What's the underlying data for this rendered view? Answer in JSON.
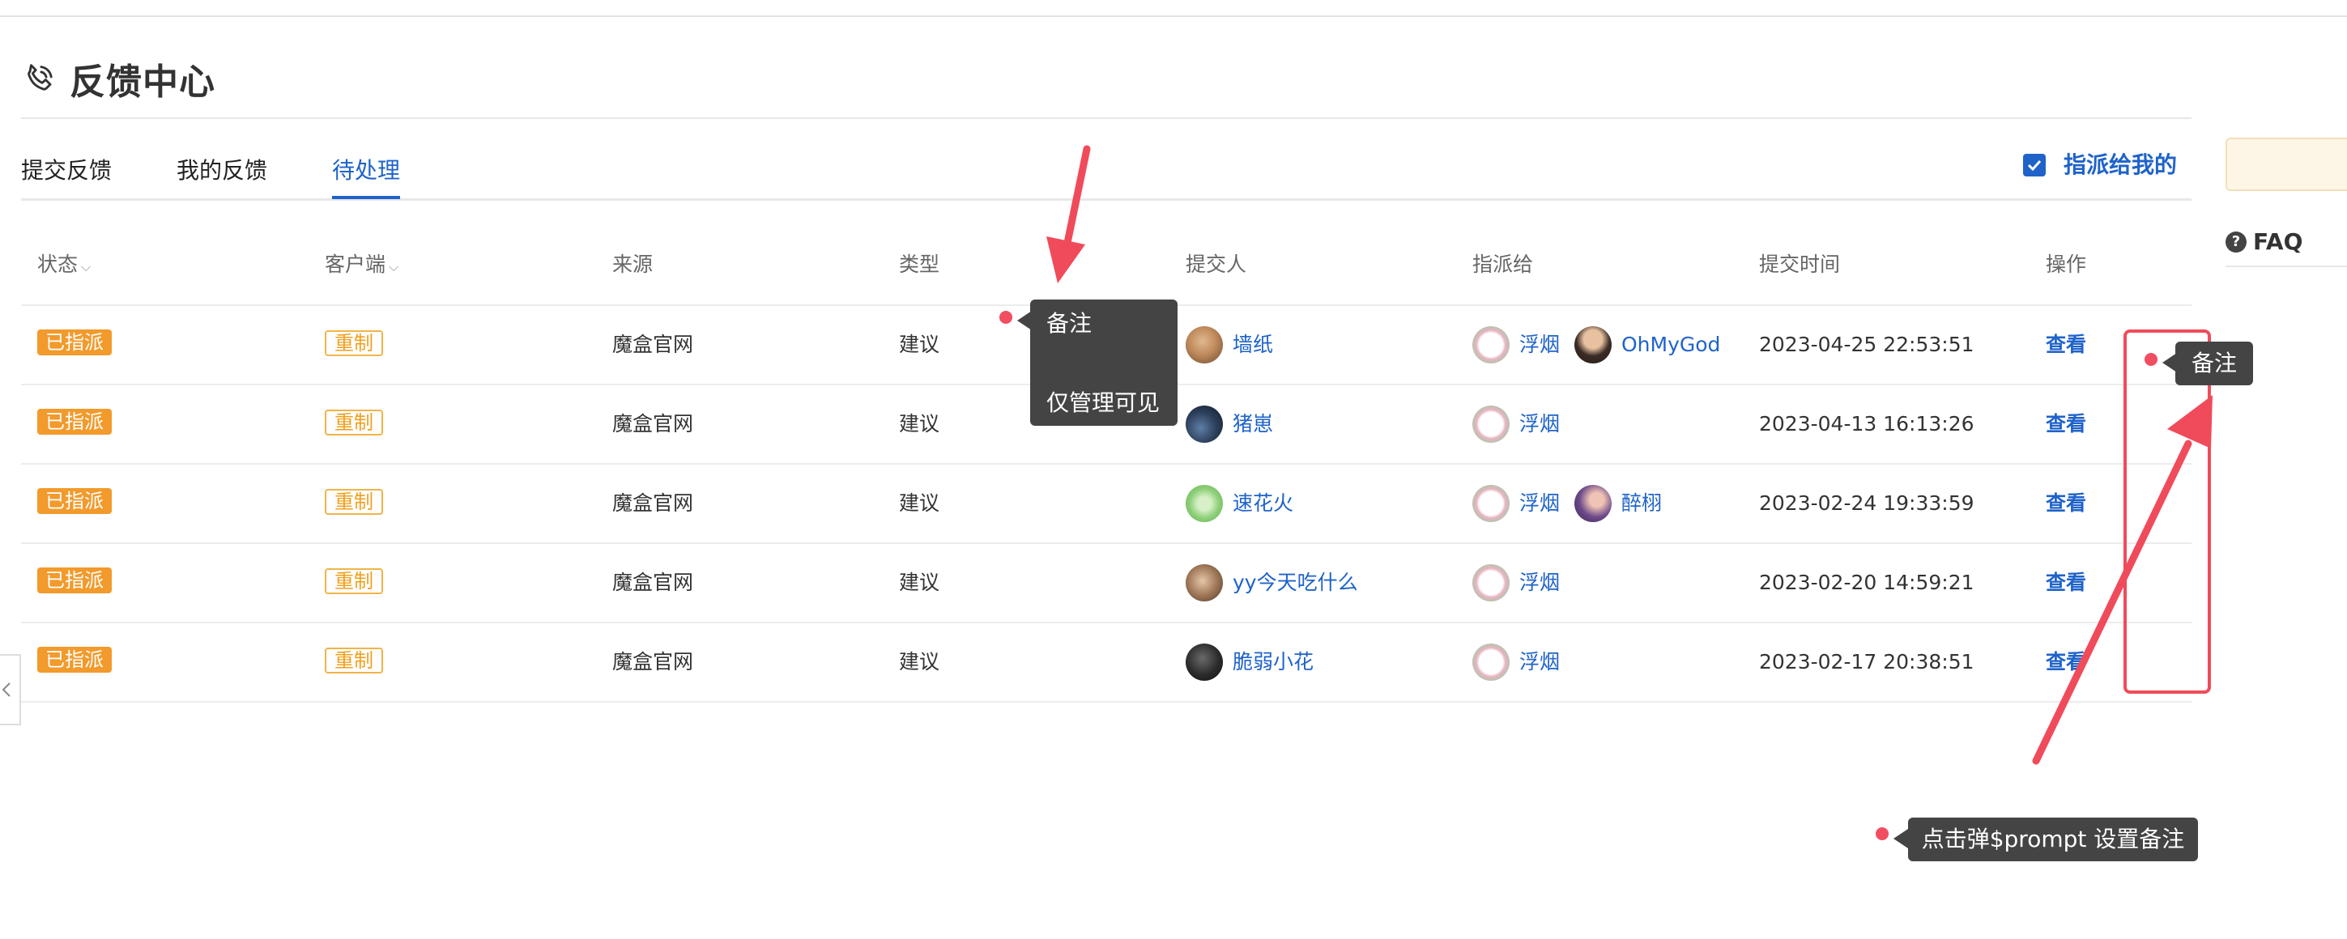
{
  "page": {
    "title": "反馈中心"
  },
  "tabs": [
    {
      "label": "提交反馈",
      "active": false
    },
    {
      "label": "我的反馈",
      "active": false
    },
    {
      "label": "待处理",
      "active": true
    }
  ],
  "filter": {
    "assigned_to_me_label": "指派给我的",
    "assigned_to_me_checked": true
  },
  "sidebar": {
    "faq_label": "FAQ"
  },
  "table": {
    "columns": [
      "状态",
      "客户端",
      "来源",
      "类型",
      "提交人",
      "指派给",
      "提交时间",
      "操作"
    ],
    "rows": [
      {
        "status": "已指派",
        "client": "重制",
        "source": "魔盒官网",
        "type": "建议",
        "submitter": "墙纸",
        "assignees": [
          "浮烟",
          "OhMyGod"
        ],
        "time": "2023-04-25 22:53:51",
        "action": "查看"
      },
      {
        "status": "已指派",
        "client": "重制",
        "source": "魔盒官网",
        "type": "建议",
        "submitter": "猪崽",
        "assignees": [
          "浮烟"
        ],
        "time": "2023-04-13 16:13:26",
        "action": "查看"
      },
      {
        "status": "已指派",
        "client": "重制",
        "source": "魔盒官网",
        "type": "建议",
        "submitter": "速花火",
        "assignees": [
          "浮烟",
          "醉栩"
        ],
        "time": "2023-02-24 19:33:59",
        "action": "查看"
      },
      {
        "status": "已指派",
        "client": "重制",
        "source": "魔盒官网",
        "type": "建议",
        "submitter": "yy今天吃什么",
        "assignees": [
          "浮烟"
        ],
        "time": "2023-02-20 14:59:21",
        "action": "查看"
      },
      {
        "status": "已指派",
        "client": "重制",
        "source": "魔盒官网",
        "type": "建议",
        "submitter": "脆弱小花",
        "assignees": [
          "浮烟"
        ],
        "time": "2023-02-17 20:38:51",
        "action": "查看"
      }
    ]
  },
  "annotations": {
    "note_tooltip_title": "备注",
    "note_tooltip_body": "仅管理可见",
    "note_column_tooltip": "备注",
    "prompt_tooltip": "点击弹$prompt 设置备注"
  },
  "colors": {
    "accent": "#1f63c9",
    "status_badge": "#f29a2b",
    "client_badge": "#f0a01e",
    "annotation_red": "#f04b5a"
  }
}
